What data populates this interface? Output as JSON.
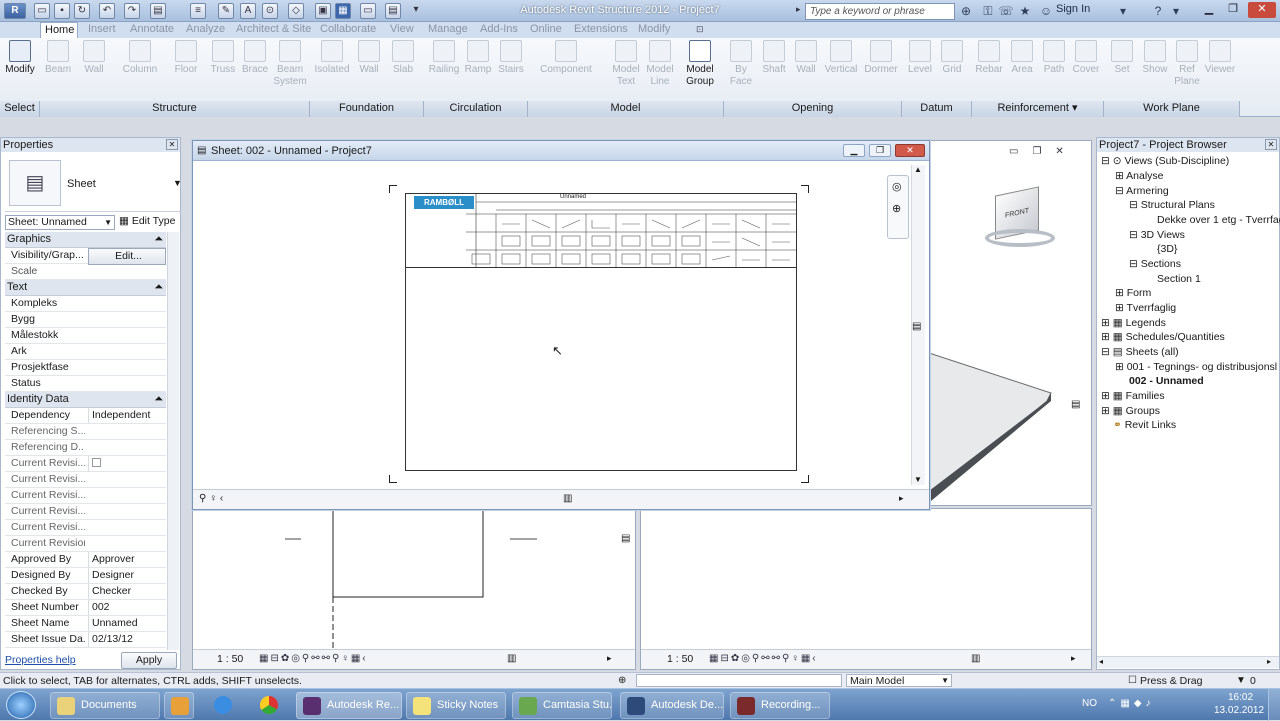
{
  "app": {
    "title": "Autodesk Revit Structure 2012 -   Project7",
    "search_placeholder": "Type a keyword or phrase",
    "signin": "Sign In"
  },
  "ribbon": {
    "tabs": [
      "Home",
      "Insert",
      "Annotate",
      "Analyze",
      "Architect & Site",
      "Collaborate",
      "View",
      "Manage",
      "Add-Ins",
      "Online",
      "Extensions",
      "Modify"
    ],
    "tools": {
      "modify": "Modify",
      "beam": "Beam",
      "wall": "Wall",
      "column": "Column",
      "floor": "Floor",
      "truss": "Truss",
      "brace": "Brace",
      "beam_system": "Beam\nSystem",
      "isolated": "Isolated",
      "wall2": "Wall",
      "slab": "Slab",
      "railing": "Railing",
      "ramp": "Ramp",
      "stairs": "Stairs",
      "component": "Component",
      "model_text": "Model\nText",
      "model_line": "Model\nLine",
      "model_group": "Model\nGroup",
      "by_face": "By\nFace",
      "shaft": "Shaft",
      "wall3": "Wall",
      "vertical": "Vertical",
      "dormer": "Dormer",
      "level": "Level",
      "grid": "Grid",
      "rebar": "Rebar",
      "area": "Area",
      "path": "Path",
      "cover": "Cover",
      "set": "Set",
      "show": "Show",
      "ref_plane": "Ref\nPlane",
      "viewer": "Viewer"
    },
    "panels": {
      "select": "Select",
      "structure": "Structure",
      "foundation": "Foundation",
      "circulation": "Circulation",
      "model": "Model",
      "opening": "Opening",
      "datum": "Datum",
      "reinforcement": "Reinforcement ▾",
      "work_plane": "Work Plane"
    }
  },
  "properties": {
    "title": "Properties",
    "type": "Sheet",
    "selector": "Sheet: Unnamed",
    "edit_type": "Edit Type",
    "groups": {
      "graphics": "Graphics",
      "text": "Text",
      "identity": "Identity Data"
    },
    "rows": [
      {
        "k": "Visibility/Grap...",
        "v": "Edit..."
      },
      {
        "k": "Scale",
        "v": ""
      },
      {
        "k": "Kompleks",
        "v": ""
      },
      {
        "k": "Bygg",
        "v": ""
      },
      {
        "k": "Målestokk",
        "v": ""
      },
      {
        "k": "Ark",
        "v": ""
      },
      {
        "k": "Prosjektfase",
        "v": ""
      },
      {
        "k": "Status",
        "v": ""
      },
      {
        "k": "Dependency",
        "v": "Independent"
      },
      {
        "k": "Referencing S...",
        "v": ""
      },
      {
        "k": "Referencing D...",
        "v": ""
      },
      {
        "k": "Current Revisi...",
        "v": ""
      },
      {
        "k": "Current Revisi...",
        "v": ""
      },
      {
        "k": "Current Revisi...",
        "v": ""
      },
      {
        "k": "Current Revisi...",
        "v": ""
      },
      {
        "k": "Current Revisi...",
        "v": ""
      },
      {
        "k": "Current Revision",
        "v": ""
      },
      {
        "k": "Approved By",
        "v": "Approver"
      },
      {
        "k": "Designed By",
        "v": "Designer"
      },
      {
        "k": "Checked By",
        "v": "Checker"
      },
      {
        "k": "Sheet Number",
        "v": "002"
      },
      {
        "k": "Sheet Name",
        "v": "Unnamed"
      },
      {
        "k": "Sheet Issue Da...",
        "v": "02/13/12"
      }
    ],
    "help": "Properties help",
    "apply": "Apply"
  },
  "sheet_window": {
    "title": "Sheet: 002 - Unnamed - Project7",
    "logo": "RAMBØLL",
    "header": "Unnamed"
  },
  "views": {
    "scale1": "1 : 50",
    "scale2": "1 : 50"
  },
  "browser": {
    "title": "Project7 - Project Browser",
    "nodes": [
      "Views (Sub-Discipline)",
      "Analyse",
      "Armering",
      "Structural Plans",
      "Dekke over 1 etg - Tverrfag",
      "3D Views",
      "{3D}",
      "Sections",
      "Section 1",
      "Form",
      "Tverrfaglig",
      "Legends",
      "Schedules/Quantities",
      "Sheets (all)",
      "001 - Tegnings- og distribusjonsl",
      "002 - Unnamed",
      "Families",
      "Groups",
      "Revit Links"
    ]
  },
  "viewcube": {
    "face": "FRONT"
  },
  "statusbar": {
    "hint": "Click to select, TAB for alternates, CTRL adds, SHIFT unselects.",
    "workset": "Main Model",
    "press_drag": "Press & Drag",
    "filter_count": "0"
  },
  "taskbar": {
    "items": [
      "Documents",
      "",
      "",
      "",
      "Autodesk Re...",
      "Sticky Notes",
      "Camtasia Stu...",
      "Autodesk De...",
      "Recording..."
    ],
    "lang": "NO",
    "time": "16:02",
    "date": "13.02.2012"
  }
}
